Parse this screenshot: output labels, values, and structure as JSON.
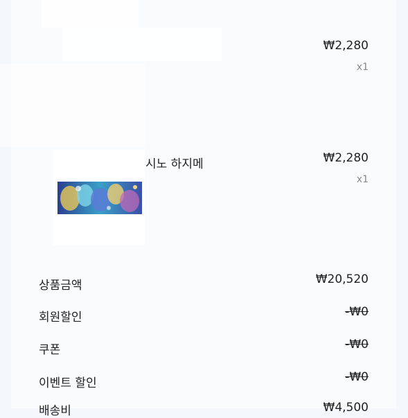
{
  "items": [
    {
      "name": "",
      "price": "₩2,280",
      "qty": "x1"
    },
    {
      "name": "시노 하지메",
      "price": "₩2,280",
      "qty": "x1",
      "thumbnail": "game-card-banner-image"
    }
  ],
  "summary": [
    {
      "label": "상품금액",
      "value": "₩20,520"
    },
    {
      "label": "회원할인",
      "value": "-₩0"
    },
    {
      "label": "쿠폰",
      "value": "-₩0"
    },
    {
      "label": "이벤트 할인",
      "value": "-₩0"
    },
    {
      "label": "배송비",
      "value": "₩4,500"
    }
  ],
  "colors": {
    "background": "#f4f7fb",
    "text": "#222222",
    "muted": "#888888"
  }
}
